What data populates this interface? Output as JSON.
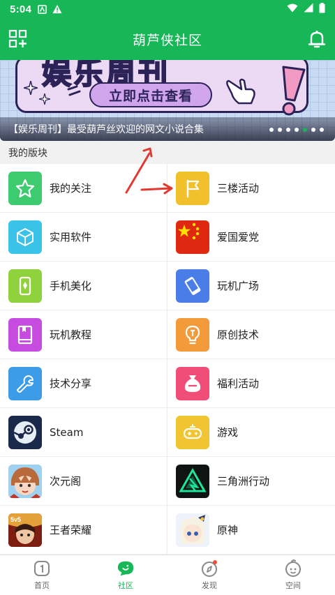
{
  "status_bar": {
    "time": "5:04"
  },
  "header": {
    "title": "葫芦侠社区"
  },
  "banner": {
    "big_text": "娱乐周刊",
    "button_text": "立即点击查看",
    "caption": "【娱乐周刊】最受葫芦丝欢迎的网文小说合集",
    "dot_count": 7,
    "active_dot": 4
  },
  "section": {
    "title": "我的版块"
  },
  "boards": [
    {
      "label": "我的关注",
      "icon": "star-icon",
      "color": "#3ecb6f"
    },
    {
      "label": "三楼活动",
      "icon": "flag-icon",
      "color": "#f1c12b"
    },
    {
      "label": "实用软件",
      "icon": "cube-icon",
      "color": "#3ac2e8"
    },
    {
      "label": "爱国爱党",
      "icon": "china-flag-icon",
      "color": "#de2910"
    },
    {
      "label": "手机美化",
      "icon": "phone-theme-icon",
      "color": "#8fd23d"
    },
    {
      "label": "玩机广场",
      "icon": "phone-tilt-icon",
      "color": "#4b7de8"
    },
    {
      "label": "玩机教程",
      "icon": "book-icon",
      "color": "#c64ce0"
    },
    {
      "label": "原创技术",
      "icon": "bulb-icon",
      "color": "#f39a3a"
    },
    {
      "label": "技术分享",
      "icon": "wrench-icon",
      "color": "#3d9ce8"
    },
    {
      "label": "福利活动",
      "icon": "bag-icon",
      "color": "#f04e77"
    },
    {
      "label": "Steam",
      "icon": "steam-icon",
      "color": "#1b2a4a"
    },
    {
      "label": "游戏",
      "icon": "gamepad-icon",
      "color": "#f0c531"
    },
    {
      "label": "次元阁",
      "icon": "anime-avatar-icon",
      "color": "#f4b9a2"
    },
    {
      "label": "三角洲行动",
      "icon": "delta-icon",
      "color": "#0f1412"
    },
    {
      "label": "王者荣耀",
      "icon": "honor-of-kings-icon",
      "color": "#c23a1f"
    },
    {
      "label": "原神",
      "icon": "genshin-icon",
      "color": "#f3eef6"
    }
  ],
  "nav": [
    {
      "label": "首页",
      "icon": "home-icon",
      "active": false
    },
    {
      "label": "社区",
      "icon": "community-icon",
      "active": true
    },
    {
      "label": "发现",
      "icon": "compass-icon",
      "active": false
    },
    {
      "label": "空间",
      "icon": "profile-icon",
      "active": false
    }
  ],
  "colors": {
    "brand": "#17b657",
    "annotation": "#e0392f"
  }
}
